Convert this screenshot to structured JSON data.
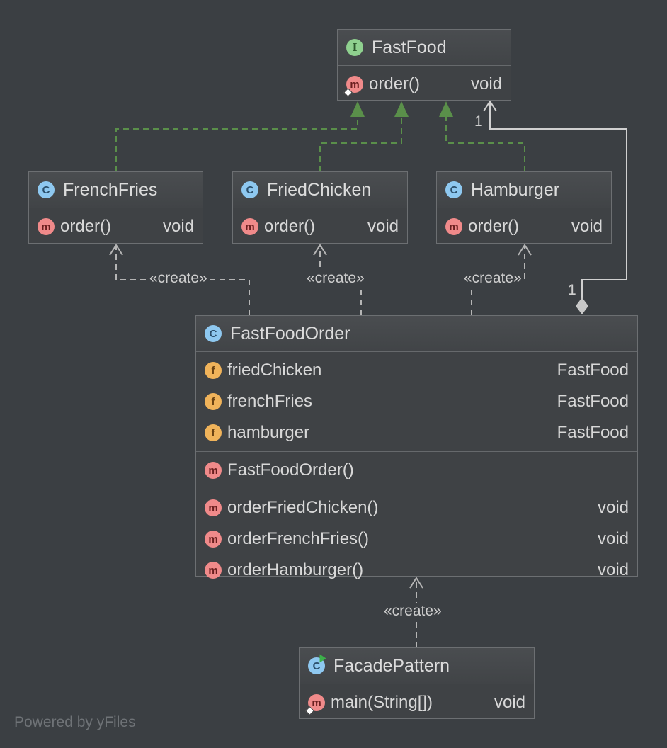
{
  "fastfood": {
    "title": "FastFood",
    "badge": "I",
    "methods": [
      {
        "name": "order()",
        "type": "void",
        "badge": "m"
      }
    ]
  },
  "frenchfries": {
    "title": "FrenchFries",
    "badge": "C",
    "methods": [
      {
        "name": "order()",
        "type": "void",
        "badge": "m"
      }
    ]
  },
  "friedchicken": {
    "title": "FriedChicken",
    "badge": "C",
    "methods": [
      {
        "name": "order()",
        "type": "void",
        "badge": "m"
      }
    ]
  },
  "hamburger": {
    "title": "Hamburger",
    "badge": "C",
    "methods": [
      {
        "name": "order()",
        "type": "void",
        "badge": "m"
      }
    ]
  },
  "fastfoodorder": {
    "title": "FastFoodOrder",
    "badge": "C",
    "fields": [
      {
        "name": "friedChicken",
        "type": "FastFood",
        "badge": "f"
      },
      {
        "name": "frenchFries",
        "type": "FastFood",
        "badge": "f"
      },
      {
        "name": "hamburger",
        "type": "FastFood",
        "badge": "f"
      }
    ],
    "constructors": [
      {
        "name": "FastFoodOrder()",
        "type": "",
        "badge": "m"
      }
    ],
    "methods": [
      {
        "name": "orderFriedChicken()",
        "type": "void",
        "badge": "m"
      },
      {
        "name": "orderFrenchFries()",
        "type": "void",
        "badge": "m"
      },
      {
        "name": "orderHamburger()",
        "type": "void",
        "badge": "m"
      }
    ]
  },
  "facade": {
    "title": "FacadePattern",
    "badge": "C",
    "methods": [
      {
        "name": "main(String[])",
        "type": "void",
        "badge": "m"
      }
    ]
  },
  "edges": {
    "create_label": "«create»",
    "mult_top": "1",
    "mult_bottom": "1"
  },
  "watermark": "Powered by yFiles",
  "colors": {
    "background": "#3b3f43",
    "realization": "#5a8f4a",
    "dependency": "#b5b5b5",
    "interface_badge": "#8fd18f",
    "class_badge": "#8ec8f0",
    "method_badge": "#f08a8a",
    "field_badge": "#f0b35a"
  }
}
